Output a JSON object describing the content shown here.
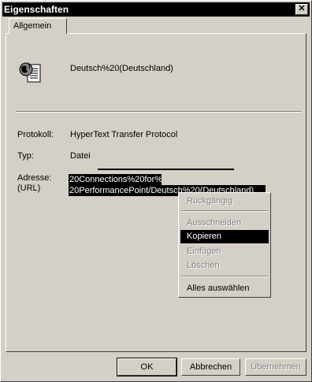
{
  "window": {
    "title": "Eigenschaften",
    "close_glyph": "✕"
  },
  "tabs": [
    {
      "label": "Allgemein"
    }
  ],
  "file": {
    "icon": "document-globe-icon",
    "name": "Deutsch%20(Deutschland)"
  },
  "properties": {
    "protocol_label": "Protokoll:",
    "protocol_value": "HyperText Transfer Protocol",
    "type_label": "Typ:",
    "type_value": "Datei",
    "address_label_1": "Adresse:",
    "address_label_2": "(URL)",
    "address_line_1": "20Connections%20for%",
    "address_line_2": "20PerformancePoint/Deutsch%20(Deutschland)"
  },
  "context_menu": {
    "items": [
      {
        "label": "Rückgängig",
        "state": "disabled"
      },
      {
        "label": "Ausschneiden",
        "state": "disabled"
      },
      {
        "label": "Kopieren",
        "state": "selected"
      },
      {
        "label": "Einfügen",
        "state": "disabled"
      },
      {
        "label": "Löschen",
        "state": "disabled"
      },
      {
        "label": "Alles auswählen",
        "state": "enabled"
      }
    ]
  },
  "buttons": {
    "ok": "OK",
    "cancel": "Abbrechen",
    "apply": "Übernehmen"
  }
}
